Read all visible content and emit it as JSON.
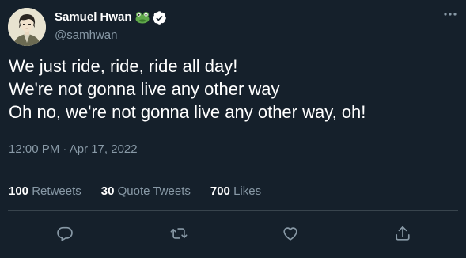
{
  "author": {
    "display_name": "Samuel Hwan",
    "handle": "@samhwan",
    "name_emoji": "frog-icon",
    "verified": true
  },
  "tweet": {
    "lines": [
      "We just ride, ride, ride all day!",
      "We're not gonna live any other way",
      "Oh no, we're not gonna live any other way, oh!"
    ],
    "timestamp": "12:00 PM · Apr 17, 2022"
  },
  "stats": {
    "retweets": {
      "count": "100",
      "label": "Retweets"
    },
    "quote_tweets": {
      "count": "30",
      "label": "Quote Tweets"
    },
    "likes": {
      "count": "700",
      "label": "Likes"
    }
  },
  "actions": [
    "reply-icon",
    "retweet-icon",
    "like-icon",
    "share-icon"
  ],
  "colors": {
    "background": "#15202b",
    "text_primary": "#ffffff",
    "text_secondary": "#8899a6",
    "divider": "#38444d",
    "verified_badge": "#ffffff",
    "icon": "#8899a6"
  }
}
